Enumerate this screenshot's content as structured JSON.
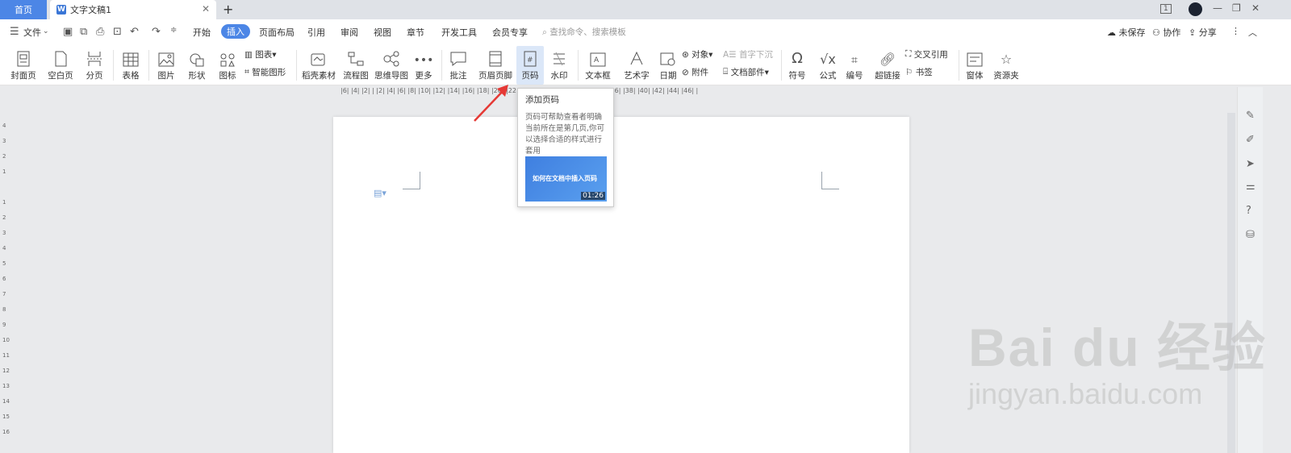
{
  "titlebar": {
    "home_tab": "首页",
    "doc_tab": "文字文稿1",
    "doc_icon": "W",
    "add": "+",
    "page_indicator": "1"
  },
  "menu": {
    "file": "文件",
    "items": [
      "开始",
      "插入",
      "页面布局",
      "引用",
      "审阅",
      "视图",
      "章节",
      "开发工具",
      "会员专享"
    ],
    "active": "插入",
    "search_placeholder": "查找命令、搜索模板",
    "unsaved": "未保存",
    "collab": "协作",
    "share": "分享"
  },
  "ribbon": {
    "cover": "封面页",
    "blank": "空白页",
    "pagebreak": "分页",
    "table": "表格",
    "picture": "图片",
    "shape": "形状",
    "icon": "图标",
    "chart": "图表",
    "smartart": "智能图形",
    "material": "稻壳素材",
    "flowchart": "流程图",
    "mindmap": "思维导图",
    "more": "更多",
    "comment": "批注",
    "headerfooter": "页眉页脚",
    "pagenum": "页码",
    "watermark": "水印",
    "textbox": "文本框",
    "wordart": "艺术字",
    "date": "日期",
    "object": "对象",
    "attachment": "附件",
    "dropcap": "首字下沉",
    "docpart": "文档部件",
    "symbol": "符号",
    "formula": "公式",
    "numbering": "编号",
    "hyperlink": "超链接",
    "crossref": "交叉引用",
    "bookmark": "书签",
    "font": "窗体",
    "resource": "资源夹"
  },
  "ruler": "|6| |4| |2| |  |2| |4| |6| |8| |10| |12| |14| |16| |18| |20| |22| |24| |26| |28| |30| |32| |34| |36| |38| |40| |42| |44| |46| |",
  "vruler": [
    "4",
    "3",
    "2",
    "1",
    "",
    "1",
    "2",
    "3",
    "4",
    "5",
    "6",
    "7",
    "8",
    "9",
    "10",
    "11",
    "12",
    "13",
    "14",
    "15",
    "16"
  ],
  "tooltip": {
    "title": "添加页码",
    "desc": "页码可帮助查看者明确当前所在是第几页,你可以选择合适的样式进行套用",
    "video_title": "如何在文档中插入页码",
    "duration": "01:26"
  },
  "watermark": {
    "main": "Bai du 经验",
    "sub": "jingyan.baidu.com"
  }
}
